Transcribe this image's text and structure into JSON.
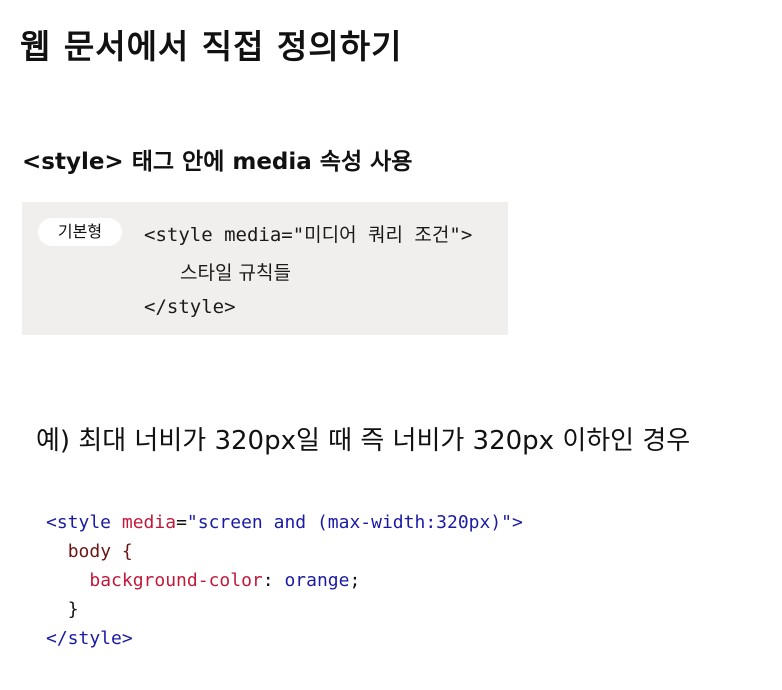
{
  "title": "웹 문서에서 직접 정의하기",
  "subtitle": "<style> 태그 안에 media 속성 사용",
  "syntax": {
    "badge": "기본형",
    "lines": [
      "<style media=\"미디어 쿼리 조건\">",
      "스타일 규칙들",
      "</style>"
    ]
  },
  "example_text": "예) 최대 너비가 320px일 때 즉 너비가 320px 이하인 경우",
  "code": {
    "open_tag": "<style",
    "attr_name": "media",
    "equals": "=",
    "attr_value": "\"screen and (max-width:320px)\"",
    "close_bracket": ">",
    "selector": "body {",
    "property": "background-color",
    "colon": ": ",
    "value": "orange",
    "semicolon": ";",
    "close_brace": "}",
    "end_tag": "</style>"
  }
}
